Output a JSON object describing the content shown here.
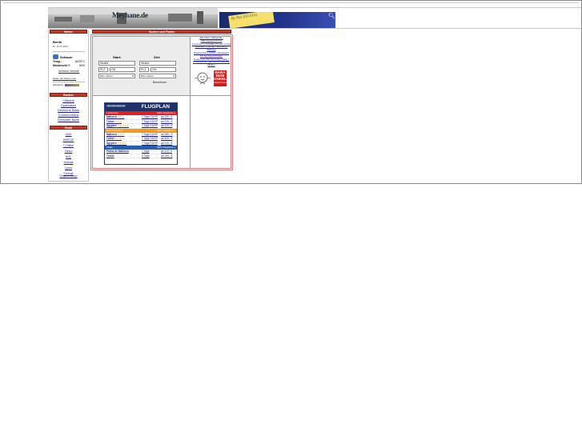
{
  "site": {
    "brand": "Meyhane.de"
  },
  "ad": {
    "note": "By Bye ED-Flirt"
  },
  "headers": {
    "weather": "Wetter",
    "main": "Suchen und Finden",
    "banks": "Banken",
    "email": "Email"
  },
  "weather": {
    "city": "Berlin",
    "date": "Di. 11.07.2011",
    "condition": "Schauer",
    "temp_label": "Temp.:",
    "temp_value": "16/25°C",
    "rain_label": "Niederschl.?:",
    "rain_value": "60%",
    "more_link": "Weitere Wetter",
    "source_link": "Daten der Wetter.com",
    "partner_text": "powered by"
  },
  "route": {
    "start_label": "Start:",
    "target_label": "Ziel:",
    "start_street": "Straße",
    "start_plz": "PLZ",
    "start_ort": "Ort",
    "start_country": "Bitte wählen",
    "target_street": "Straße",
    "target_plz": "PLZ",
    "target_ort": "Ort",
    "target_country": "Bitte wählen",
    "calc_button": "Berechnen"
  },
  "links": {
    "line1": "Alle Infos | Wikipedia | Haftungsausschluss",
    "line2": "Impressum | Kontakt | Presse | Links",
    "line3": "Meyhane | Partner | Werbung | Sitemap",
    "line4": "Datenschutz | Archiv | Newsletter",
    "promo": "FE Sachbuchfinden",
    "line5": "Kostenlose Kleinanzeigen Baby / Kindersachen gebraucht. Bitte hier klicken"
  },
  "baba": {
    "line1": "BABA",
    "line2": "BENI",
    "line3": "ONKEL",
    "small": "Kinderzimmer"
  },
  "banks": [
    "Citibank",
    "Sparkasse",
    "Deutsche Bank",
    "Commerzbank",
    "Dresdner Bank"
  ],
  "email_links": [
    "GMX",
    "WEB.DE",
    "T-Online",
    "Yahoo",
    "AOL",
    "Hotmail",
    "Lycos",
    "Freenet"
  ],
  "shop_link": "Online-Shop",
  "flugplan": {
    "source": "ab-in-den-urlaub.de",
    "title": "FLUGPLAN",
    "sections": [
      {
        "name": "Lastminute",
        "more": "Mehr Angebote »",
        "rows": [
          {
            "dest": "Mallorca",
            "stars": "★★★",
            "dur": "7 Tage DZ/HP",
            "price": "ab 189,- €"
          },
          {
            "dest": "Türkei",
            "stars": "★★★",
            "dur": "7 Tage DZ/HP",
            "price": "ab 229,- €"
          },
          {
            "dest": "Ägypten",
            "stars": "★★★★★",
            "dur": "7 Tage DZ/HP",
            "price": "ab 329,- €"
          }
        ]
      },
      {
        "name": "Pauschalreisen",
        "more": "Mehr Angebote »",
        "rows": [
          {
            "dest": "Mallorca",
            "stars": "★★★",
            "dur": "7 Tage DZ/HP",
            "price": "ab 289,- €"
          },
          {
            "dest": "Türkei",
            "stars": "★★★",
            "dur": "7 Tage DZ/HP",
            "price": "ab 309,- €"
          },
          {
            "dest": "Ägypten",
            "stars": "★★★★",
            "dur": "7 Tage DZ/HP",
            "price": "ab 419,- €"
          }
        ]
      },
      {
        "name": "Flüge",
        "more": "Mehr Angebote »",
        "rows": [
          {
            "dest": "Palma de Mallorca",
            "stars": "",
            "dur": "7 Tage",
            "price": "ab 119,- €"
          },
          {
            "dest": "Türkei",
            "stars": "",
            "dur": "6 Tage",
            "price": "ab 169,- €"
          }
        ]
      }
    ]
  }
}
